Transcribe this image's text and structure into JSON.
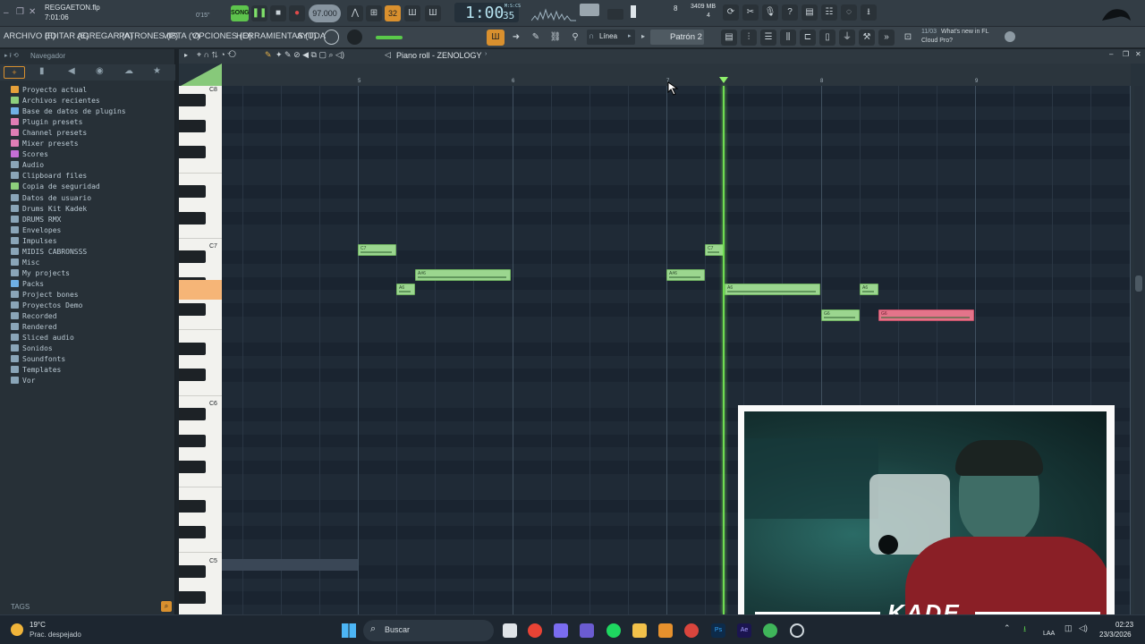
{
  "topbar": {
    "project_file": "REGGAETON.flp",
    "time_small": "7:01:06",
    "time_offset": "0'15\"",
    "song_mode": "SONG",
    "tempo": "97.000",
    "pattern_num": "32",
    "counter": "1:00",
    "counter_small": "35",
    "counter_label": "M:S:CS",
    "cpu_value": "8",
    "mem_value": "3409 MB",
    "mem_sub": "4"
  },
  "menubar": {
    "items": [
      "ARCHIVO (F)",
      "EDITAR (E)",
      "AGREGAR (A)",
      "PATRONES (P)",
      "VISTA (V)",
      "OPCIONES (O)",
      "HERRAMIENTAS (T)",
      "AYUDA"
    ],
    "snap_mode": "Línea",
    "pattern": "Patrón 2",
    "news_date": "11/03",
    "news_title": "What's new in FL",
    "news_sub": "Cloud Pro?"
  },
  "browser": {
    "title": "Navegador",
    "tags_label": "TAGS",
    "items": [
      {
        "label": "Proyecto actual",
        "color": "#e6a03a"
      },
      {
        "label": "Archivos recientes",
        "color": "#8dcf7c"
      },
      {
        "label": "Base de datos de plugins",
        "color": "#6fb0e6"
      },
      {
        "label": "Plugin presets",
        "color": "#e07eb5"
      },
      {
        "label": "Channel presets",
        "color": "#e07eb5"
      },
      {
        "label": "Mixer presets",
        "color": "#e07eb5"
      },
      {
        "label": "Scores",
        "color": "#c56fd6"
      },
      {
        "label": "Audio",
        "color": "#8aa5b8"
      },
      {
        "label": "Clipboard files",
        "color": "#8aa5b8"
      },
      {
        "label": "Copia de seguridad",
        "color": "#8dcf7c"
      },
      {
        "label": "Datos de usuario",
        "color": "#8aa5b8"
      },
      {
        "label": "Drums Kit Kadek",
        "color": "#8aa5b8"
      },
      {
        "label": "DRUMS RMX",
        "color": "#8aa5b8"
      },
      {
        "label": "Envelopes",
        "color": "#8aa5b8"
      },
      {
        "label": "Impulses",
        "color": "#8aa5b8"
      },
      {
        "label": "MIDIS CABRONSSS",
        "color": "#8aa5b8"
      },
      {
        "label": "Misc",
        "color": "#8aa5b8"
      },
      {
        "label": "My projects",
        "color": "#8aa5b8"
      },
      {
        "label": "Packs",
        "color": "#6fb0e6"
      },
      {
        "label": "Project bones",
        "color": "#8aa5b8"
      },
      {
        "label": "Proyectos Demo",
        "color": "#8aa5b8"
      },
      {
        "label": "Recorded",
        "color": "#8aa5b8"
      },
      {
        "label": "Rendered",
        "color": "#8aa5b8"
      },
      {
        "label": "Sliced audio",
        "color": "#8aa5b8"
      },
      {
        "label": "Sonidos",
        "color": "#8aa5b8"
      },
      {
        "label": "Soundfonts",
        "color": "#8aa5b8"
      },
      {
        "label": "Templates",
        "color": "#8aa5b8"
      },
      {
        "label": "Vor",
        "color": "#8aa5b8"
      }
    ]
  },
  "piano_roll": {
    "title": "Piano roll - ZENOLOGY",
    "bar_numbers": [
      "5",
      "6",
      "7",
      "8",
      "9"
    ],
    "octave_labels": [
      "C8",
      "C7",
      "C6",
      "C5"
    ],
    "notes": [
      {
        "label": "C7",
        "color": "green"
      },
      {
        "label": "A#6",
        "color": "green"
      },
      {
        "label": "A6",
        "color": "green"
      },
      {
        "label": "A#6",
        "color": "green"
      },
      {
        "label": "C7",
        "color": "green"
      },
      {
        "label": "A6",
        "color": "green"
      },
      {
        "label": "G6",
        "color": "green"
      },
      {
        "label": "A6",
        "color": "green"
      },
      {
        "label": "G6",
        "color": "red"
      }
    ]
  },
  "webcam": {
    "overlay_text": "KADE"
  },
  "taskbar": {
    "weather_temp": "19°C",
    "weather_desc": "Prac. despejado",
    "search_placeholder": "Buscar",
    "lang": "LAA",
    "time": "02:23",
    "date": "23/3/2026"
  }
}
